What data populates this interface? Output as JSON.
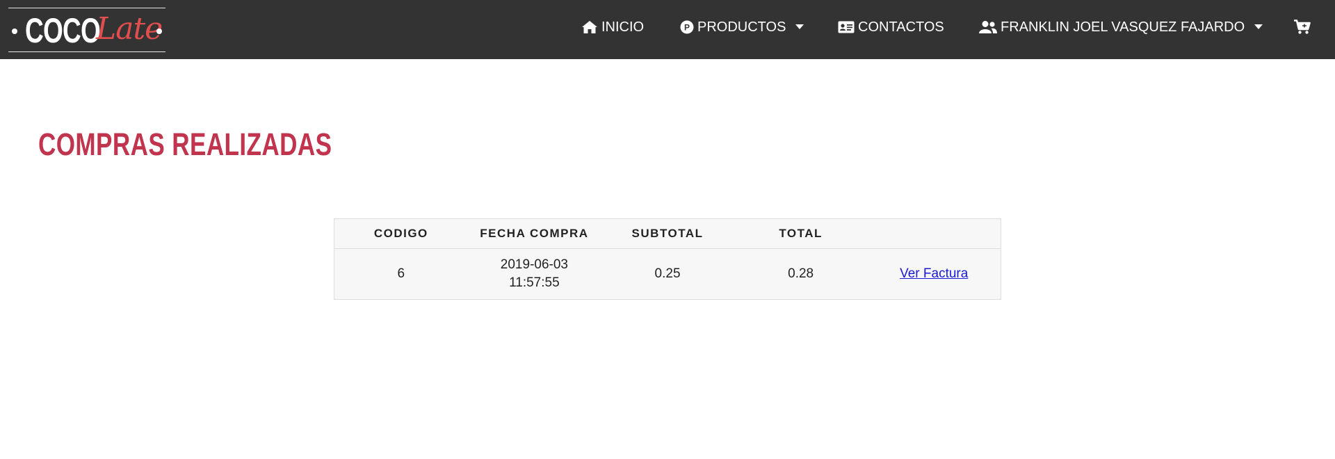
{
  "brand": {
    "part1": "COCO",
    "part2": "Late"
  },
  "nav": {
    "home": "INICIO",
    "products": "PRODUCTOS",
    "contacts": "CONTACTOS",
    "user": "FRANKLIN JOEL VASQUEZ FAJARDO"
  },
  "icons": {
    "home": "home-icon",
    "products": "products-badge-icon",
    "contacts": "id-card-icon",
    "user": "users-icon",
    "cart": "shopping-cart-icon"
  },
  "page": {
    "title": "COMPRAS REALIZADAS"
  },
  "table": {
    "headers": [
      "CODIGO",
      "FECHA COMPRA",
      "SUBTOTAL",
      "TOTAL",
      ""
    ],
    "rows": [
      {
        "codigo": "6",
        "fecha_date": "2019-06-03",
        "fecha_time": "11:57:55",
        "subtotal": "0.25",
        "total": "0.28",
        "link": "Ver Factura"
      }
    ]
  },
  "colors": {
    "navbar": "#333333",
    "title": "#c0344e",
    "logo_accent": "#e04e4e",
    "link": "#1a1ad6"
  }
}
